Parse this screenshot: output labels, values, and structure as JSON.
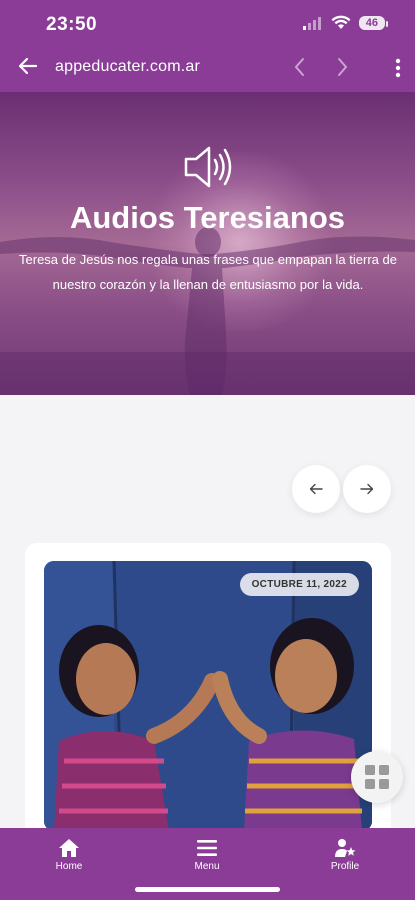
{
  "status_bar": {
    "time": "23:50",
    "battery": "46"
  },
  "browser": {
    "url": "appeducater.com.ar"
  },
  "hero": {
    "title": "Audios Teresianos",
    "description": "Teresa de Jesús nos regala unas frases que empapan la tierra de nuestro corazón y la llenan de entusiasmo por la vida."
  },
  "post": {
    "date": "OCTUBRE 11, 2022"
  },
  "bottom_nav": {
    "home": "Home",
    "menu": "Menu",
    "profile": "Profile"
  },
  "colors": {
    "brand": "#8a3c96",
    "page_bg": "#f4f4f6"
  }
}
